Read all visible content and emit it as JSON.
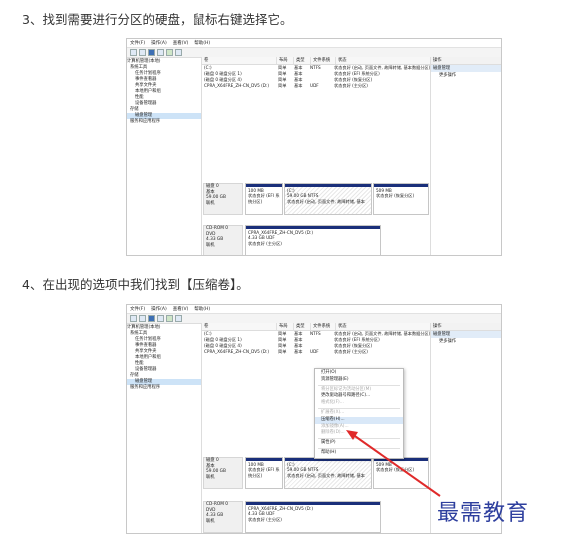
{
  "step3": {
    "text": "3、找到需要进行分区的硬盘，鼠标右键选择它。"
  },
  "step4": {
    "text": "4、在出现的选项中我们找到【压缩卷】。"
  },
  "window": {
    "menu": [
      "文件(F)",
      "操作(A)",
      "查看(V)",
      "帮助(H)"
    ],
    "tree": [
      "计算机管理(本地)",
      "系统工具",
      "任务计划程序",
      "事件查看器",
      "共享文件夹",
      "本地用户和组",
      "性能",
      "设备管理器",
      "存储",
      "磁盘管理",
      "服务和应用程序"
    ],
    "columns": [
      "卷",
      "布局",
      "类型",
      "文件系统",
      "状态"
    ],
    "volumes": [
      {
        "vol": "(C:)",
        "layout": "简单",
        "type": "基本",
        "fs": "NTFS",
        "status": "状态良好 (启动, 页面文件, 故障转储, 基本数据分区)"
      },
      {
        "vol": "(磁盘 0 磁盘分区 1)",
        "layout": "简单",
        "type": "基本",
        "fs": "",
        "status": "状态良好 (EFI 系统分区)"
      },
      {
        "vol": "(磁盘 0 磁盘分区 4)",
        "layout": "简单",
        "type": "基本",
        "fs": "",
        "status": "状态良好 (恢复分区)"
      },
      {
        "vol": "CPRA_X64FRE_ZH-CN_DV5 (D:)",
        "layout": "简单",
        "type": "基本",
        "fs": "UDF",
        "status": "状态良好 (主分区)"
      }
    ],
    "actions_header": "操作",
    "actions_sub": "磁盘管理",
    "actions_more": "更多操作",
    "disk0": {
      "name": "磁盘 0",
      "type": "基本",
      "size": "59.00 GB",
      "state": "联机"
    },
    "disk0_parts": [
      {
        "title": "",
        "size": "100 MB",
        "status": "状态良好 (EFI 系统分区)"
      },
      {
        "title": "(C:)",
        "size": "59.00 GB NTFS",
        "status": "状态良好 (启动, 页面文件, 故障转储, 基本"
      },
      {
        "title": "",
        "size": "509 MB",
        "status": "状态良好 (恢复分区)"
      }
    ],
    "cdrom": {
      "name": "CD-ROM 0",
      "type": "DVD",
      "size": "4.33 GB",
      "state": "联机"
    },
    "cdrom_part": {
      "title": "CPRA_X64FRE_ZH-CN_DV5 (D:)",
      "size": "4.33 GB UDF",
      "status": "状态良好 (主分区)"
    }
  },
  "context_menu": [
    "打开(O)",
    "资源管理器(E)",
    "将分区标记为活动分区(M)",
    "更改驱动器号和路径(C)...",
    "格式化(F)...",
    "扩展卷(X)...",
    "压缩卷(H)...",
    "添加镜像(A)...",
    "删除卷(D)...",
    "属性(P)",
    "帮助(H)"
  ],
  "watermark": "最需教育"
}
